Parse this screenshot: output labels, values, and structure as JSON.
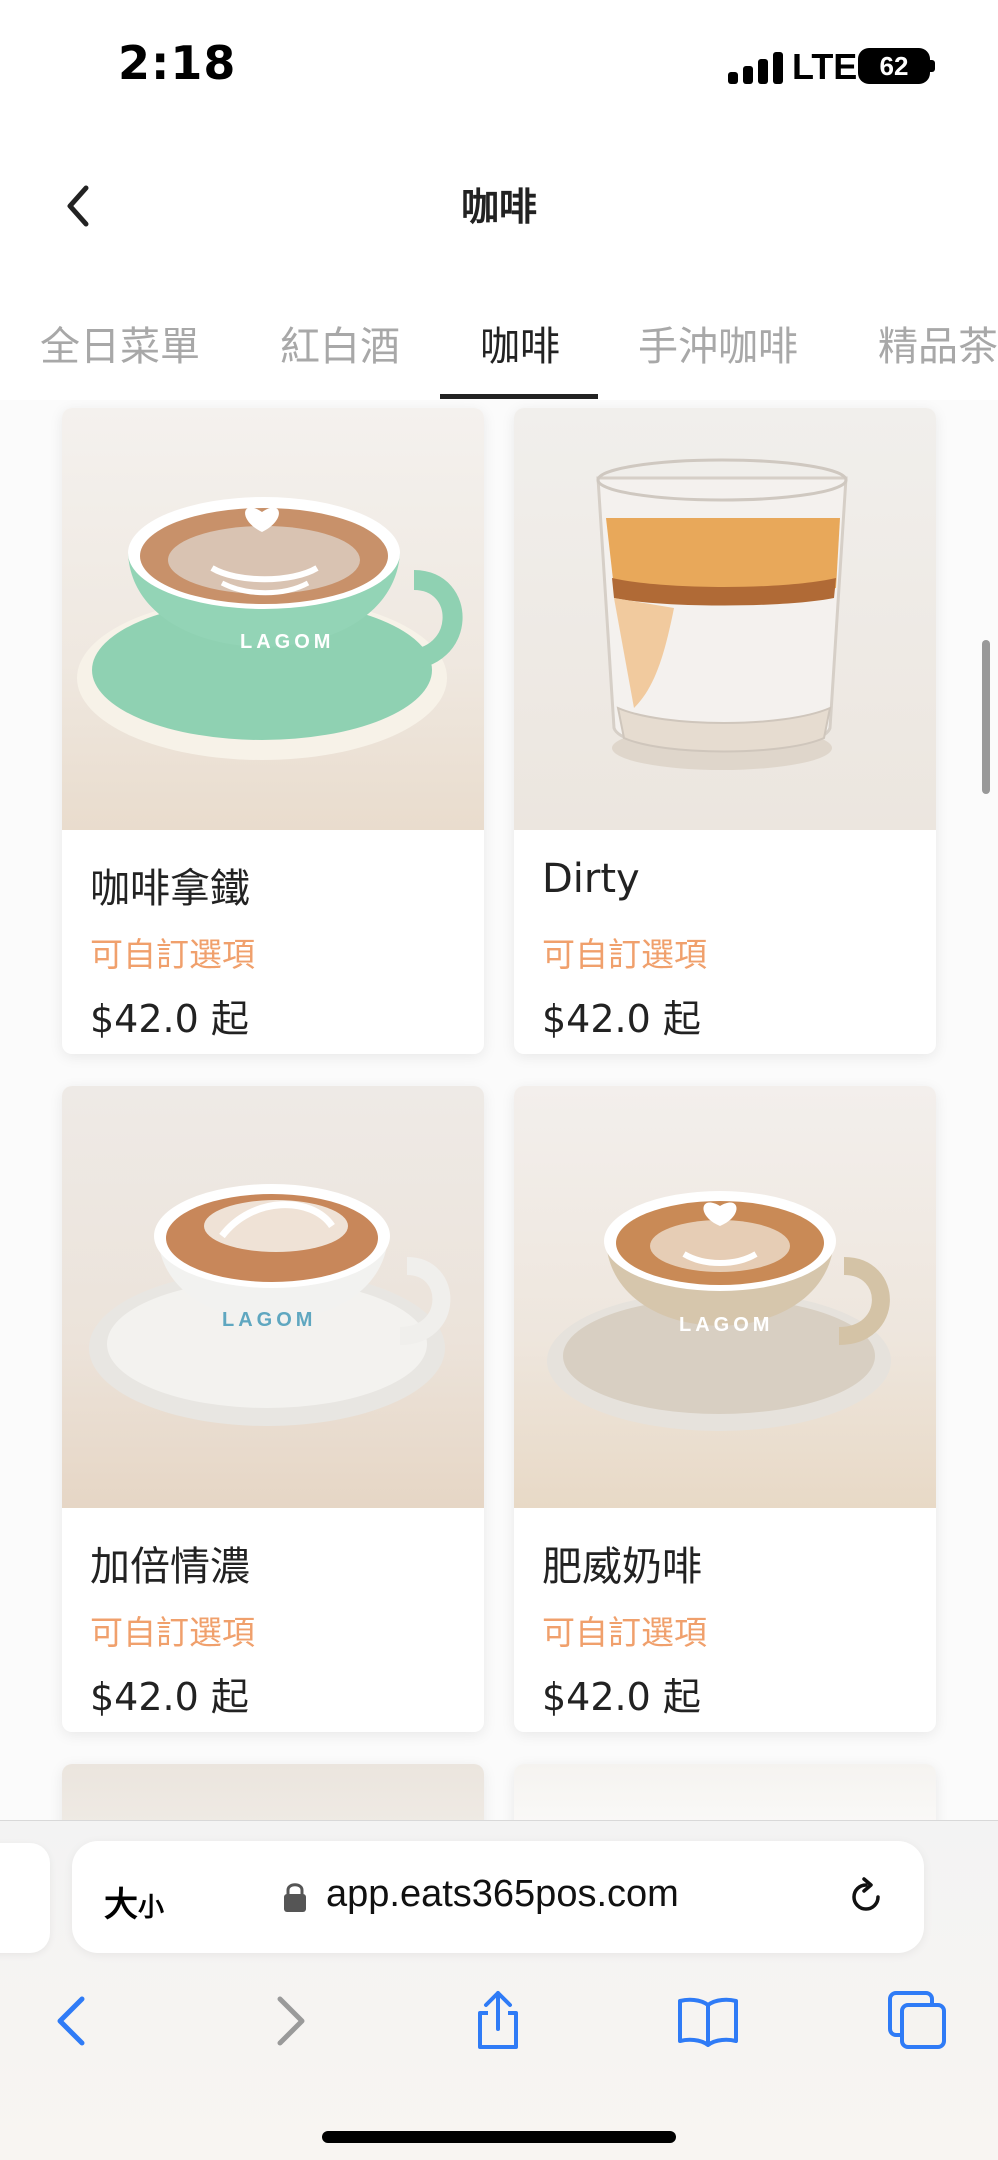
{
  "status_bar": {
    "time": "2:18",
    "network": "LTE",
    "battery": "62"
  },
  "header": {
    "title": "咖啡"
  },
  "tabs": [
    {
      "label": "全日菜單"
    },
    {
      "label": "紅白酒"
    },
    {
      "label": "咖啡"
    },
    {
      "label": "手沖咖啡"
    },
    {
      "label": "精品茶"
    }
  ],
  "active_tab": "咖啡",
  "menu_items": [
    {
      "name": "咖啡拿鐵",
      "customizable": "可自訂選項",
      "price": "$42.0 起",
      "cup_text": "LAGOM",
      "cup_color": "#8fd1b2"
    },
    {
      "name": "Dirty",
      "customizable": "可自訂選項",
      "price": "$42.0 起"
    },
    {
      "name": "加倍情濃",
      "customizable": "可自訂選項",
      "price": "$42.0 起",
      "cup_text": "LAGOM",
      "cup_color": "#f2f2f0"
    },
    {
      "name": "肥威奶啡",
      "customizable": "可自訂選項",
      "price": "$42.0 起",
      "cup_text": "LAGOM",
      "cup_color": "#d6c6ac"
    }
  ],
  "browser": {
    "text_size_label_big": "大",
    "text_size_label_small": "小",
    "url": "app.eats365pos.com"
  },
  "colors": {
    "accent": "#f0a06c",
    "ios_blue": "#2f7bf6"
  }
}
